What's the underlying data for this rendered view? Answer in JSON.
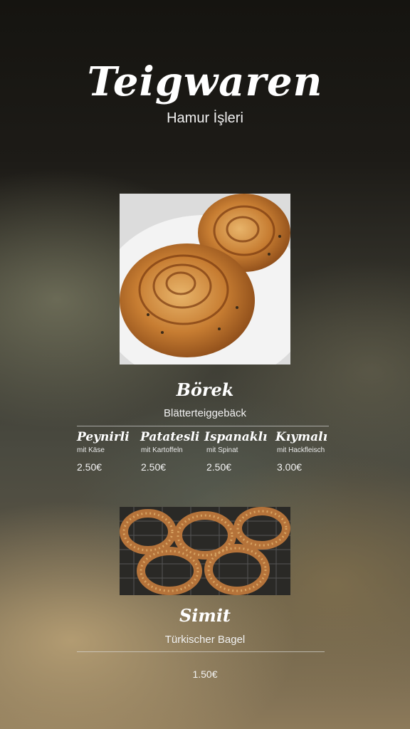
{
  "header": {
    "title": "Teigwaren",
    "subtitle": "Hamur İşleri"
  },
  "borek": {
    "name": "Börek",
    "description": "Blätterteiggebäck",
    "variants": [
      {
        "name": "Peynirli",
        "sub": "mit Käse",
        "price": "2.50€"
      },
      {
        "name": "Patatesli",
        "sub": "mit Kartoffeln",
        "price": "2.50€"
      },
      {
        "name": "Ispanaklı",
        "sub": "mit Spinat",
        "price": "2.50€"
      },
      {
        "name": "Kıymalı",
        "sub": "mit Hackfleisch",
        "price": "3.00€"
      }
    ]
  },
  "simit": {
    "name": "Simit",
    "description": "Türkischer Bagel",
    "price": "1.50€"
  }
}
